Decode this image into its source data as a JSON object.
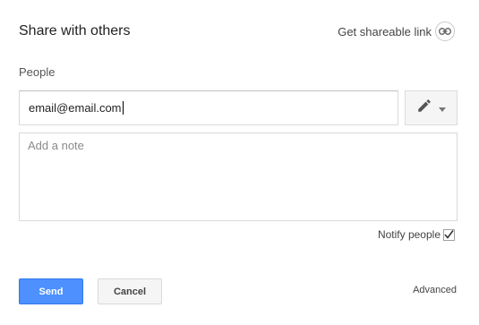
{
  "dialog": {
    "title": "Share with others",
    "share_link_label": "Get shareable link",
    "people_label": "People"
  },
  "email": {
    "value": "email@email.com"
  },
  "permission": {
    "icon": "pencil-icon",
    "dropdown_icon": "caret-down-icon"
  },
  "note": {
    "placeholder": "Add a note"
  },
  "notify": {
    "label": "Notify people",
    "checked": true
  },
  "actions": {
    "send_label": "Send",
    "cancel_label": "Cancel",
    "advanced_label": "Advanced"
  },
  "colors": {
    "primary": "#4d90fe",
    "primary_border": "#3079ed"
  }
}
